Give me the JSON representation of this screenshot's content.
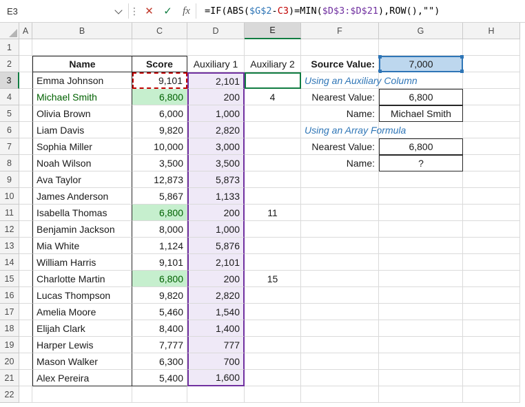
{
  "name_box": {
    "value": "E3"
  },
  "formula_bar": {
    "cancel_label": "✕",
    "enter_label": "✓",
    "fx_label": "fx",
    "dots_icon": "⋮",
    "formula_full": "=IF(ABS($G$2-C3)=MIN($D$3:$D$21),ROW(),\"\")",
    "segments": [
      {
        "text": "=IF(ABS(",
        "color": "black"
      },
      {
        "text": "$G$2",
        "color": "blue"
      },
      {
        "text": "-",
        "color": "black"
      },
      {
        "text": "C3",
        "color": "red"
      },
      {
        "text": ")=MIN(",
        "color": "black"
      },
      {
        "text": "$D$3:$D$21",
        "color": "purple"
      },
      {
        "text": "),ROW(),\"\")",
        "color": "black"
      }
    ]
  },
  "sheet": {
    "column_headers": [
      "A",
      "B",
      "C",
      "D",
      "E",
      "F",
      "G",
      "H"
    ],
    "selected_column": "E",
    "selected_row": 3,
    "rows": [
      {
        "n": 1,
        "cells": {}
      },
      {
        "n": 2,
        "cells": {
          "B": "Name",
          "C": "Score",
          "D": "Auxiliary 1",
          "E": "Auxiliary 2",
          "F": "Source Value:",
          "G": "7,000"
        }
      },
      {
        "n": 3,
        "cells": {
          "B": "Emma Johnson",
          "C": "9,101",
          "D": "2,101",
          "F": "Using an Auxiliary Column"
        }
      },
      {
        "n": 4,
        "cells": {
          "B": "Michael Smith",
          "C": "6,800",
          "D": "200",
          "E": "4",
          "F": "Nearest Value:",
          "G": "6,800"
        }
      },
      {
        "n": 5,
        "cells": {
          "B": "Olivia Brown",
          "C": "6,000",
          "D": "1,000",
          "F": "Name:",
          "G": "Michael Smith"
        }
      },
      {
        "n": 6,
        "cells": {
          "B": "Liam Davis",
          "C": "9,820",
          "D": "2,820",
          "F": "Using an Array Formula"
        }
      },
      {
        "n": 7,
        "cells": {
          "B": "Sophia Miller",
          "C": "10,000",
          "D": "3,000",
          "F": "Nearest Value:",
          "G": "6,800"
        }
      },
      {
        "n": 8,
        "cells": {
          "B": "Noah Wilson",
          "C": "3,500",
          "D": "3,500",
          "F": "Name:",
          "G": "?"
        }
      },
      {
        "n": 9,
        "cells": {
          "B": "Ava Taylor",
          "C": "12,873",
          "D": "5,873"
        }
      },
      {
        "n": 10,
        "cells": {
          "B": "James Anderson",
          "C": "5,867",
          "D": "1,133"
        }
      },
      {
        "n": 11,
        "cells": {
          "B": "Isabella Thomas",
          "C": "6,800",
          "D": "200",
          "E": "11"
        }
      },
      {
        "n": 12,
        "cells": {
          "B": "Benjamin Jackson",
          "C": "8,000",
          "D": "1,000"
        }
      },
      {
        "n": 13,
        "cells": {
          "B": "Mia White",
          "C": "1,124",
          "D": "5,876"
        }
      },
      {
        "n": 14,
        "cells": {
          "B": "William Harris",
          "C": "9,101",
          "D": "2,101"
        }
      },
      {
        "n": 15,
        "cells": {
          "B": "Charlotte Martin",
          "C": "6,800",
          "D": "200",
          "E": "15"
        }
      },
      {
        "n": 16,
        "cells": {
          "B": "Lucas Thompson",
          "C": "9,820",
          "D": "2,820"
        }
      },
      {
        "n": 17,
        "cells": {
          "B": "Amelia Moore",
          "C": "5,460",
          "D": "1,540"
        }
      },
      {
        "n": 18,
        "cells": {
          "B": "Elijah Clark",
          "C": "8,400",
          "D": "1,400"
        }
      },
      {
        "n": 19,
        "cells": {
          "B": "Harper Lewis",
          "C": "7,777",
          "D": "777"
        }
      },
      {
        "n": 20,
        "cells": {
          "B": "Mason Walker",
          "C": "6,300",
          "D": "700"
        }
      },
      {
        "n": 21,
        "cells": {
          "B": "Alex Pereira",
          "C": "5,400",
          "D": "1,600"
        }
      },
      {
        "n": 22,
        "cells": {}
      }
    ]
  },
  "highlights": {
    "active_cell": "E3",
    "selected_reference_cell": "G2",
    "red_reference_cell": "C3",
    "purple_range_column": "D",
    "purple_range_rows": [
      3,
      21
    ],
    "green_fill_cells": [
      "C4",
      "C11",
      "C15"
    ],
    "green_text_cells": [
      "B4"
    ],
    "boxed_cells": [
      "G4",
      "G5",
      "G7",
      "G8"
    ],
    "note_cells": [
      "F3",
      "F6"
    ],
    "bold_cells": [
      "B2",
      "C2",
      "F2"
    ]
  },
  "colors": {
    "accent_green": "#107C41",
    "ref_blue": "#2E75B6",
    "ref_red": "#C00000",
    "ref_purple": "#7030A0",
    "good_fill": "#C6EFCE",
    "good_text": "#006100",
    "selected_fill": "#BDD7EE"
  }
}
